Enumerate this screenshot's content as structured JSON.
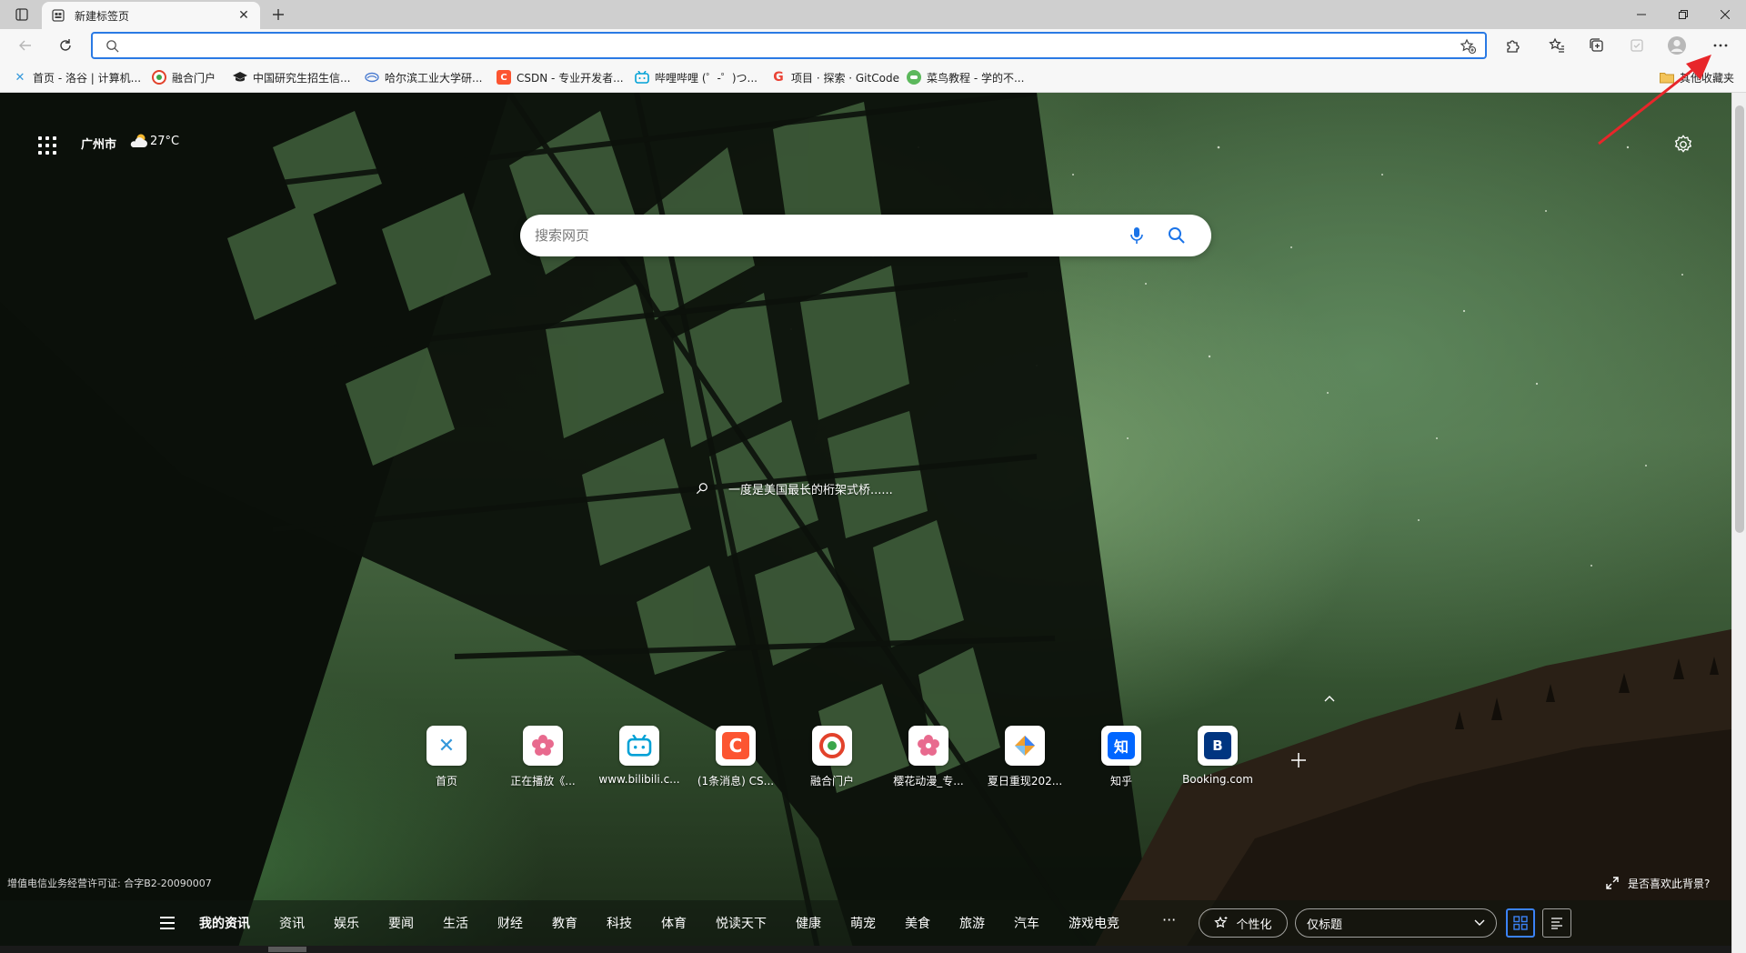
{
  "window": {
    "tab": {
      "title": "新建标签页"
    },
    "controls": {
      "minimize": "minimize",
      "maximize": "restore",
      "close": "close"
    }
  },
  "toolbar": {
    "address": {
      "value": "",
      "placeholder": ""
    }
  },
  "favorites": {
    "items": [
      {
        "label": "首页 - 洛谷 | 计算机...",
        "icon": "luogu-icon",
        "color": "#3498db"
      },
      {
        "label": "融合门户",
        "icon": "portal-icon",
        "color": "#e2422b"
      },
      {
        "label": "中国研究生招生信...",
        "icon": "graduation-cap-icon",
        "color": "#222222"
      },
      {
        "label": "哈尔滨工业大学研...",
        "icon": "hit-icon",
        "color": "#4a7bd0"
      },
      {
        "label": "CSDN - 专业开发者...",
        "icon": "csdn-icon",
        "color": "#fc5531"
      },
      {
        "label": "哔哩哔哩 (゜-゜)つ...",
        "icon": "bilibili-icon",
        "color": "#00a1d6"
      },
      {
        "label": "项目 · 探索 · GitCode",
        "icon": "google-icon",
        "color": "#ea4335"
      },
      {
        "label": "菜鸟教程 - 学的不...",
        "icon": "runoob-icon",
        "color": "#5cb85c"
      }
    ],
    "other": "其他收藏夹"
  },
  "page": {
    "location": {
      "city": "广州市",
      "temperature": "27°C"
    },
    "search": {
      "placeholder": "搜索网页"
    },
    "caption": "一度是美国最长的桁架式桥......",
    "tiles": [
      {
        "label": "首页",
        "icon": "luogu-icon",
        "color": "#3498db"
      },
      {
        "label": "正在播放《...",
        "icon": "sakura-icon",
        "color": "#e86a8e"
      },
      {
        "label": "www.bilibili.c...",
        "icon": "bilibili-icon",
        "color": "#00a1d6"
      },
      {
        "label": "(1条消息) CS...",
        "icon": "csdn-icon",
        "color": "#fc5531"
      },
      {
        "label": "融合门户",
        "icon": "portal-icon",
        "color": "#e2422b"
      },
      {
        "label": "樱花动漫_专...",
        "icon": "sakura-icon",
        "color": "#e86a8e"
      },
      {
        "label": "夏日重现202...",
        "icon": "kite-icon",
        "color": "#f0a030"
      },
      {
        "label": "知乎",
        "icon": "zhihu-icon",
        "color": "#0066ff"
      },
      {
        "label": "Booking.com",
        "icon": "booking-icon",
        "color": "#003580"
      }
    ],
    "license": "增值电信业务经营许可证: 合字B2-20090007",
    "like_background": "是否喜欢此背景?"
  },
  "newsbar": {
    "tabs": [
      "我的资讯",
      "资讯",
      "娱乐",
      "要闻",
      "生活",
      "财经",
      "教育",
      "科技",
      "体育",
      "悦读天下",
      "健康",
      "萌宠",
      "美食",
      "旅游",
      "汽车",
      "游戏电竞"
    ],
    "more": "···",
    "personalize": "个性化",
    "layout_selected": "仅标题"
  },
  "colors": {
    "accent": "#2a7ae4",
    "annotation": "#e8262a"
  }
}
